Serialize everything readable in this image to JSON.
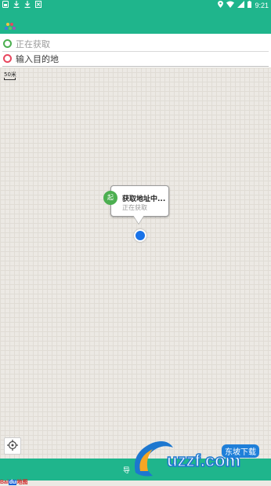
{
  "status_bar": {
    "time": "9:21",
    "icons": [
      "app-icon",
      "download-icon",
      "download-icon",
      "close-box-icon",
      "location-icon",
      "wifi-icon",
      "signal-icon",
      "battery-icon"
    ]
  },
  "search": {
    "start_text": "正在获取",
    "destination_placeholder": "输入目的地",
    "start_color": "#4caf50",
    "destination_color": "#e8475f"
  },
  "map": {
    "scale_label": "50米",
    "callout_title": "获取地址中...",
    "callout_subtitle": "正在获取",
    "start_badge": "起",
    "location_dot_color": "#1a73e8"
  },
  "bottom_bar": {
    "text": "导"
  },
  "baidu_logo": {
    "bai": "Bai",
    "du": "du",
    "map": "地图"
  },
  "watermark": {
    "brand": "uzzf.com",
    "badge": "东坡下载"
  },
  "colors": {
    "primary": "#1fb58c"
  }
}
